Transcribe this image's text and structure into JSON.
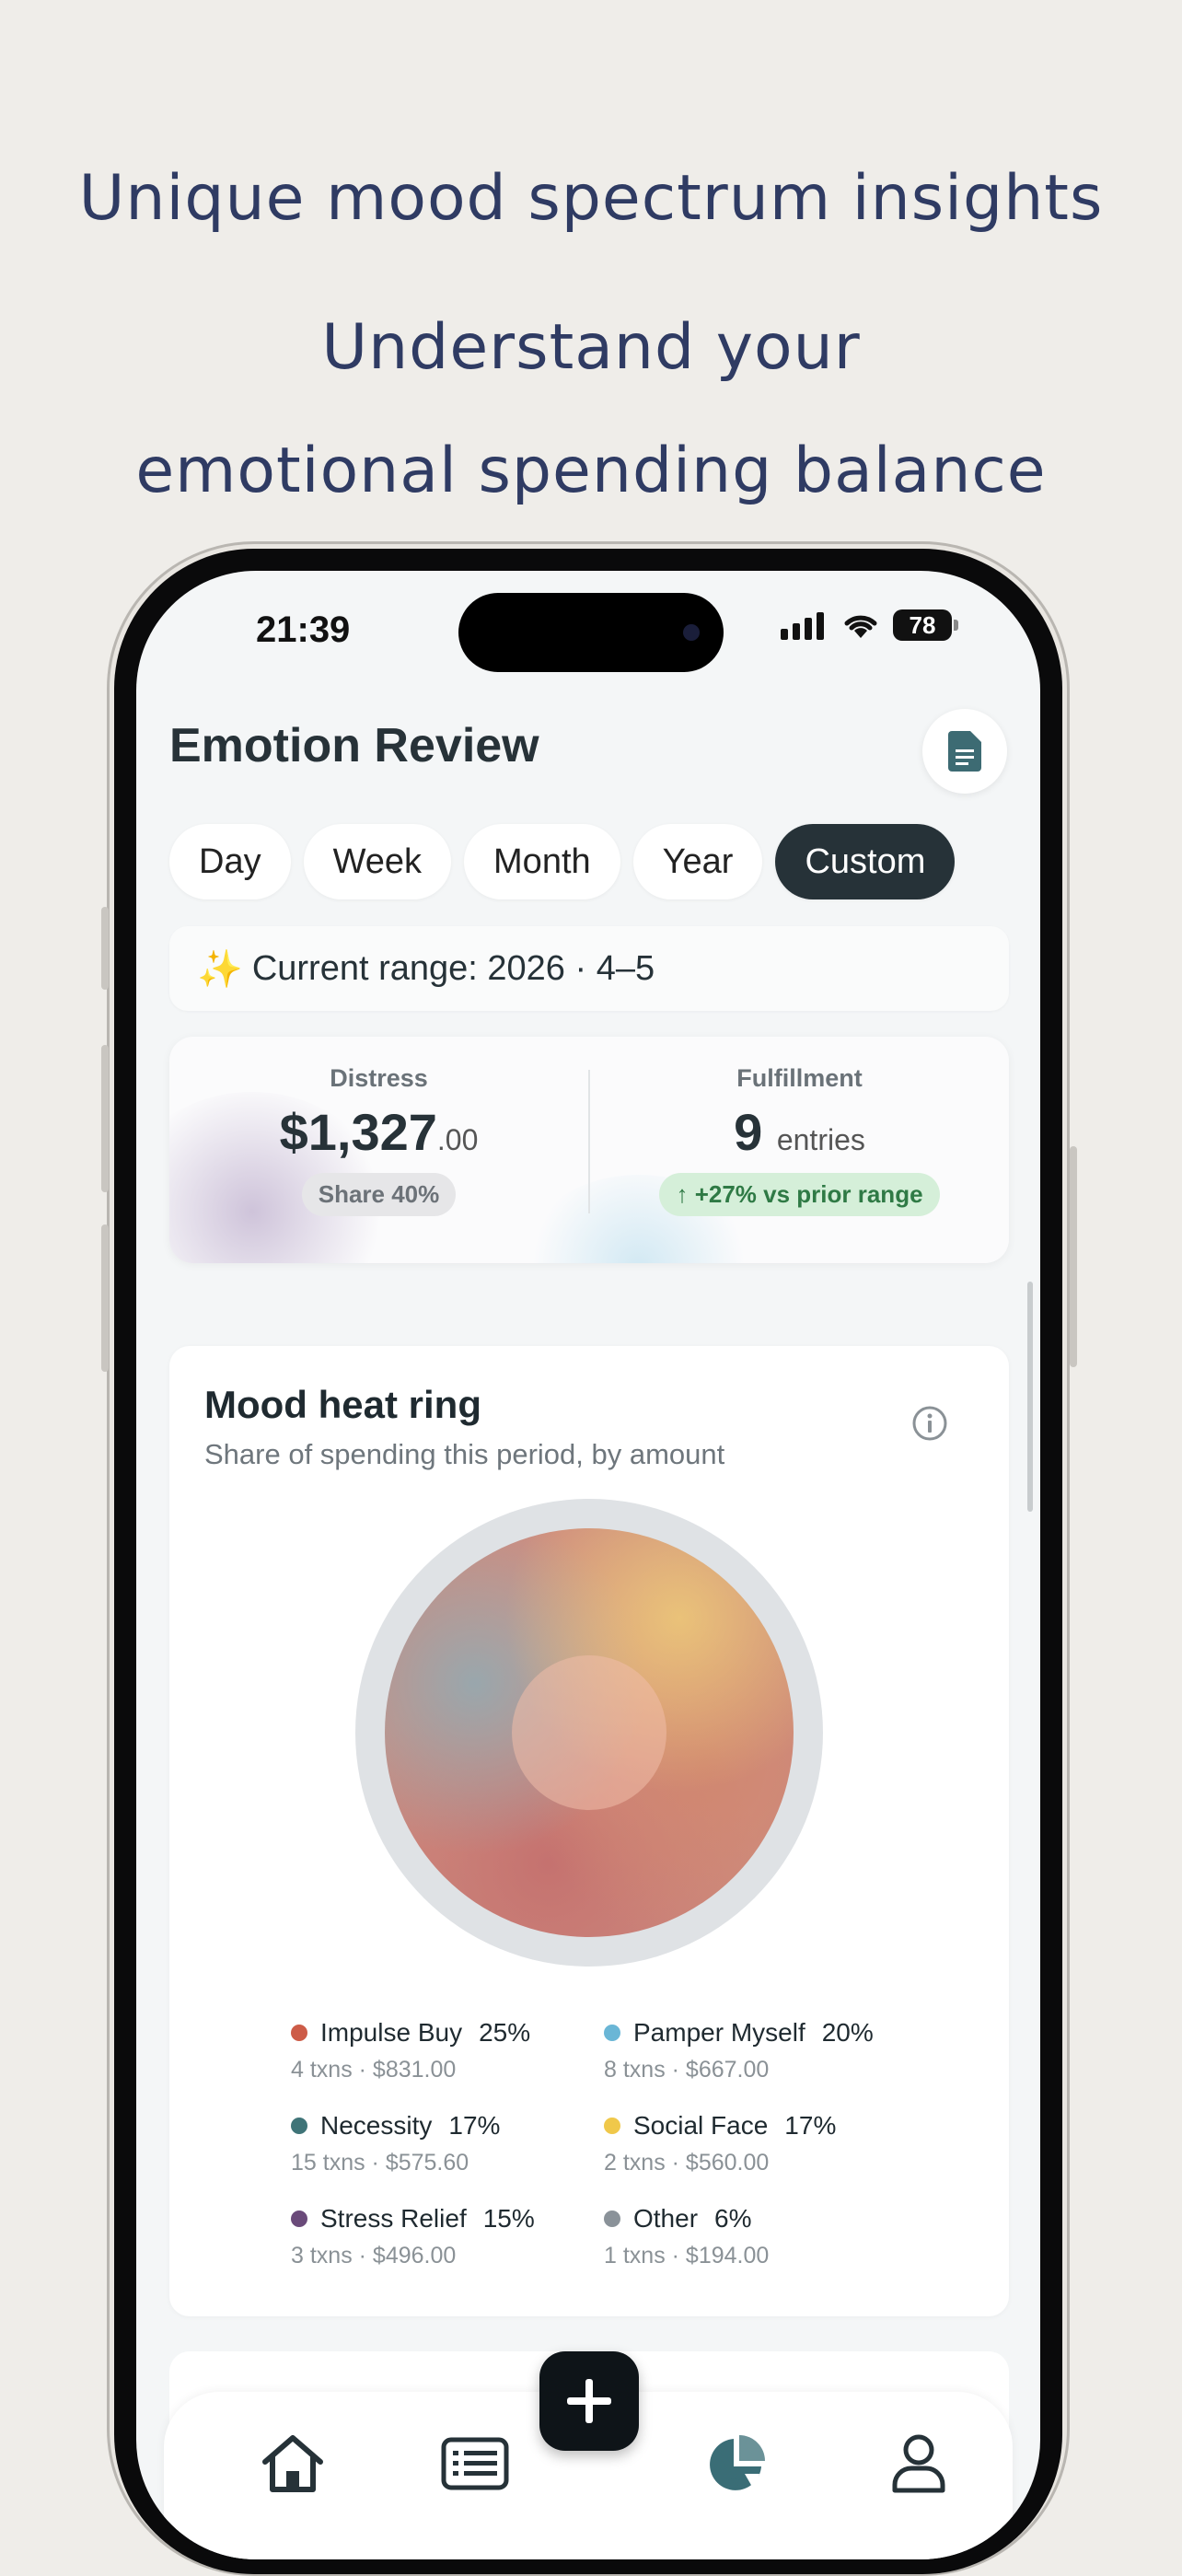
{
  "promo": {
    "line1": "Unique mood spectrum insights",
    "line2": "Understand your",
    "line3": "emotional spending balance"
  },
  "status": {
    "time": "21:39",
    "battery": "78"
  },
  "header": {
    "title": "Emotion Review",
    "doc_icon": "document-icon"
  },
  "tabs": [
    {
      "label": "Day"
    },
    {
      "label": "Week"
    },
    {
      "label": "Month"
    },
    {
      "label": "Year"
    },
    {
      "label": "Custom",
      "active": true
    }
  ],
  "range": {
    "icon": "✨",
    "text": "Current range: 2026 · 4–5"
  },
  "summary": {
    "distress": {
      "label": "Distress",
      "value": "$1,327",
      "cents": ".00",
      "badge": "Share 40%"
    },
    "fulfillment": {
      "label": "Fulfillment",
      "value": "9",
      "unit": "entries",
      "badge": "↑ +27% vs prior range"
    }
  },
  "mood_card": {
    "title": "Mood heat ring",
    "subtitle": "Share of spending this period, by amount",
    "legend": [
      {
        "name": "Impulse Buy",
        "pct": "25%",
        "meta": "4 txns · $831.00",
        "color": "#cd5c48"
      },
      {
        "name": "Pamper Myself",
        "pct": "20%",
        "meta": "8 txns · $667.00",
        "color": "#6ab6d6"
      },
      {
        "name": "Necessity",
        "pct": "17%",
        "meta": "15 txns · $575.60",
        "color": "#3f7478"
      },
      {
        "name": "Social Face",
        "pct": "17%",
        "meta": "2 txns · $560.00",
        "color": "#f0c84a"
      },
      {
        "name": "Stress Relief",
        "pct": "15%",
        "meta": "3 txns · $496.00",
        "color": "#6a4a7a"
      },
      {
        "name": "Other",
        "pct": "6%",
        "meta": "1 txns · $194.00",
        "color": "#8a9299"
      }
    ]
  },
  "nav": {
    "items": [
      "home-icon",
      "list-icon",
      "add-icon",
      "chart-icon",
      "profile-icon"
    ],
    "active": "chart-icon"
  }
}
